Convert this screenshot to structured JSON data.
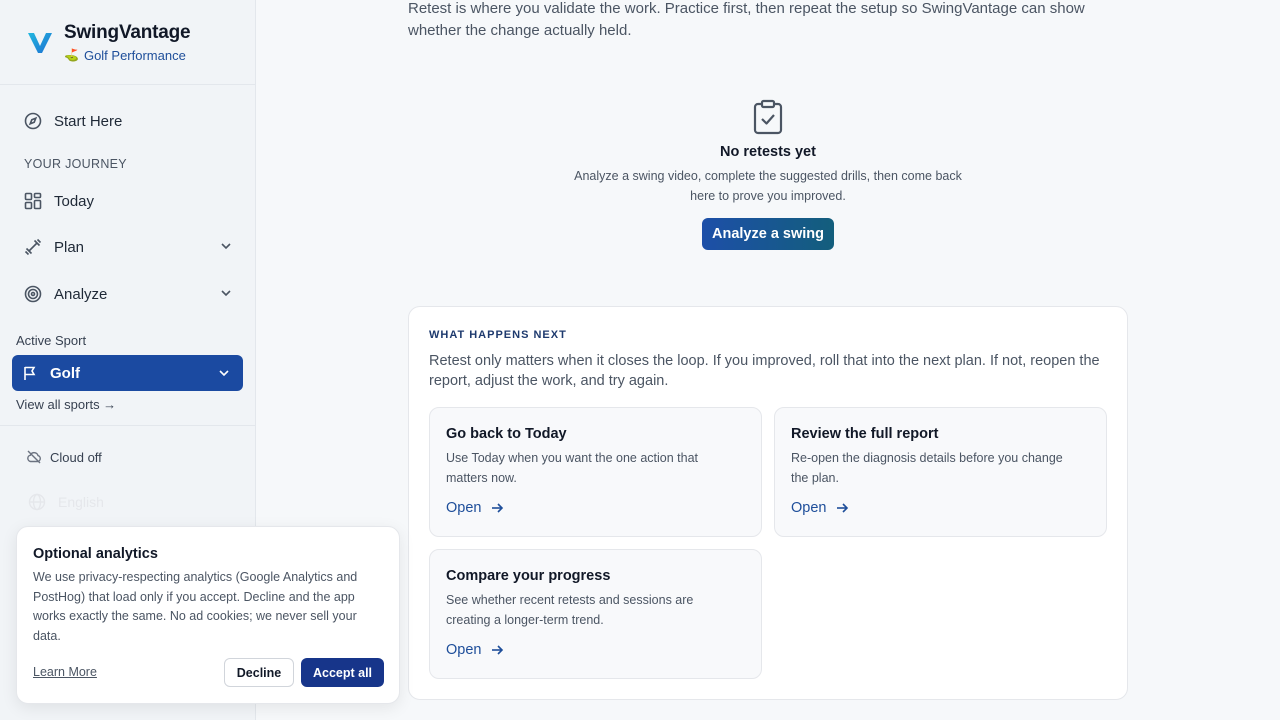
{
  "brand": {
    "name": "SwingVantage",
    "subtitle": "Golf Performance",
    "subtitle_icon": "⛳"
  },
  "sidebar": {
    "start_here": "Start Here",
    "section_journey": "YOUR JOURNEY",
    "items": [
      {
        "label": "Today",
        "icon": "dashboard-icon"
      },
      {
        "label": "Plan",
        "icon": "dumbbell-icon"
      },
      {
        "label": "Analyze",
        "icon": "target-icon"
      }
    ],
    "active_sport_label": "Active Sport",
    "active_sport": "Golf",
    "view_all_sports": "View all sports →",
    "cloud_status": "Cloud off",
    "language": "English"
  },
  "main": {
    "intro": "Retest is where you validate the work. Practice first, then repeat the setup so SwingVantage can show whether the change actually held.",
    "empty_title": "No retests yet",
    "empty_desc": "Analyze a swing video, complete the suggested drills, then come back here to prove you improved.",
    "analyze_button": "Analyze a swing",
    "next": {
      "label": "WHAT HAPPENS NEXT",
      "text": "Retest only matters when it closes the loop. If you improved, roll that into the next plan. If not, reopen the report, adjust the work, and try again.",
      "cards": [
        {
          "title": "Go back to Today",
          "desc": "Use Today when you want the one action that matters now.",
          "link": "Open"
        },
        {
          "title": "Review the full report",
          "desc": "Re-open the diagnosis details before you change the plan.",
          "link": "Open"
        },
        {
          "title": "Compare your progress",
          "desc": "See whether recent retests and sessions are creating a longer-term trend.",
          "link": "Open"
        }
      ]
    }
  },
  "cookie": {
    "title": "Optional analytics",
    "text": "We use privacy-respecting analytics (Google Analytics and PostHog) that load only if you accept. Decline and the app works exactly the same. No ad cookies; we never sell your data.",
    "learn_more": "Learn More",
    "decline": "Decline",
    "accept": "Accept all"
  },
  "colors": {
    "accent": "#1b4aa1",
    "accent_dark": "#17358a",
    "link": "#1e4e9a",
    "logo": "#1aa3d9"
  }
}
